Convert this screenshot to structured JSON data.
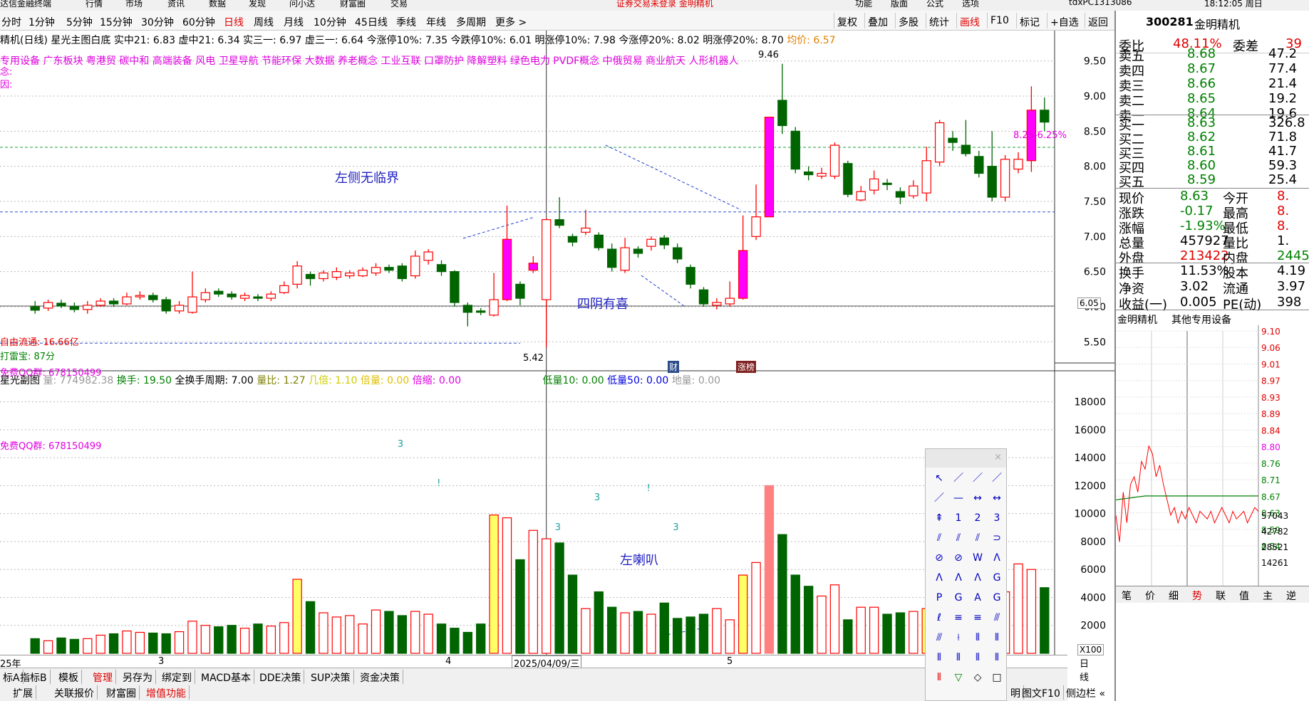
{
  "menu": {
    "items": [
      "达信金融终端",
      "行情",
      "市场",
      "资讯",
      "数据",
      "发现",
      "问小达",
      "财富圈",
      "交易"
    ],
    "notice": "证券交易未登录 金明精机",
    "right": [
      "功能",
      "版面",
      "公式",
      "选项"
    ],
    "account": "tdxPC1313086",
    "clock": "18:12:05 周日"
  },
  "periods": [
    "分时",
    "1分钟",
    "5分钟",
    "15分钟",
    "30分钟",
    "60分钟",
    "日线",
    "周线",
    "月线",
    "10分钟",
    "45日线",
    "季线",
    "年线",
    "多周期",
    "更多 >"
  ],
  "active_period": "日线",
  "toolbar": [
    "复权",
    "叠加",
    "多股",
    "统计",
    "画线",
    "F10",
    "标记",
    "+自选",
    "返回"
  ],
  "indicator_line": {
    "name": "精机(日线)",
    "items": [
      {
        "t": "星光主图白底",
        "c": "#000"
      },
      {
        "t": "实中21: 6.83",
        "c": "#000"
      },
      {
        "t": "虚中21: 6.34",
        "c": "#000"
      },
      {
        "t": "实三一: 6.97",
        "c": "#000"
      },
      {
        "t": "虚三一: 6.64",
        "c": "#000"
      },
      {
        "t": "今涨停10%: 7.35",
        "c": "#000"
      },
      {
        "t": "今跌停10%: 6.01",
        "c": "#000"
      },
      {
        "t": "明涨停10%: 7.98",
        "c": "#000"
      },
      {
        "t": "今涨停20%: 8.02",
        "c": "#000"
      },
      {
        "t": "明涨停20%: 8.70",
        "c": "#000"
      },
      {
        "t": "均价: 6.57",
        "c": "#e08000"
      }
    ]
  },
  "concepts": "专用设备  广东板块  粤港贸 碳中和 高端装备 风电 卫星导航 节能环保 大数据 养老概念 工业互联 口罩防护 降解塑料 绿色电力 PVDF概念 中俄贸易 商业航天 人形机器人",
  "side_labels": {
    "l1": "念:",
    "l2": "因:",
    "free_float": "自由流通: 16.66亿",
    "score": "打雷宝: 87分",
    "qq": "免费QQ群: 678150499"
  },
  "annotations": {
    "left_no_critical": "左侧无临界",
    "four_yin": "四阴有喜",
    "left_horn": "左喇叭",
    "high": "9.46",
    "low": "5.42",
    "band": "8.25-6.25%",
    "tag_cai": "财",
    "tag_zhang": "涨榜",
    "cursor_price": "6.05"
  },
  "sub_info": {
    "name": "星光副图",
    "items": [
      {
        "t": "量: 774982.38",
        "c": "#999"
      },
      {
        "t": "换手: 19.50",
        "c": "#008000"
      },
      {
        "t": "全换手周期: 7.00",
        "c": "#000"
      },
      {
        "t": "量比: 1.27",
        "c": "#808000"
      },
      {
        "t": "几倍: 1.10",
        "c": "#cccc00"
      },
      {
        "t": "倍量: 0.00",
        "c": "#e0c000"
      },
      {
        "t": "倍缩: 0.00",
        "c": "#e000e0"
      },
      {
        "t": "低量10: 0.00",
        "c": "#008000"
      },
      {
        "t": "低量50: 0.00",
        "c": "#0000e0"
      },
      {
        "t": "地量: 0.00",
        "c": "#999"
      }
    ]
  },
  "price_axis": [
    "9.50",
    "9.00",
    "8.50",
    "8.00",
    "7.50",
    "7.00",
    "6.50",
    "6.00",
    "5.50"
  ],
  "vol_axis": [
    "18000",
    "16000",
    "14000",
    "12000",
    "10000",
    "8000",
    "6000",
    "4000",
    "2000"
  ],
  "vol_unit": "X100",
  "dates": {
    "y": "25年",
    "m3": "3",
    "m4": "4",
    "cursor": "2025/04/09/三",
    "m5": "5",
    "period": "日线"
  },
  "chart_data": {
    "type": "candlestick",
    "ylim": [
      5.3,
      9.7
    ],
    "candles": [
      [
        6.0,
        5.95,
        6.08,
        5.9
      ],
      [
        5.98,
        6.06,
        6.1,
        5.94
      ],
      [
        6.05,
        6.01,
        6.1,
        5.98
      ],
      [
        6.0,
        5.96,
        6.06,
        5.92
      ],
      [
        5.96,
        6.02,
        6.08,
        5.9
      ],
      [
        6.02,
        6.08,
        6.12,
        6.0
      ],
      [
        6.08,
        6.04,
        6.12,
        6.0
      ],
      [
        6.04,
        6.14,
        6.2,
        6.02
      ],
      [
        6.14,
        6.16,
        6.22,
        6.1
      ],
      [
        6.16,
        6.1,
        6.2,
        6.06
      ],
      [
        6.1,
        5.94,
        6.14,
        5.9
      ],
      [
        5.94,
        6.02,
        6.08,
        5.9
      ],
      [
        5.92,
        6.14,
        6.5,
        5.9
      ],
      [
        6.1,
        6.2,
        6.26,
        6.06
      ],
      [
        6.22,
        6.18,
        6.26,
        6.14
      ],
      [
        6.18,
        6.14,
        6.22,
        6.1
      ],
      [
        6.12,
        6.16,
        6.2,
        6.08
      ],
      [
        6.14,
        6.12,
        6.18,
        6.08
      ],
      [
        6.12,
        6.18,
        6.22,
        6.08
      ],
      [
        6.2,
        6.3,
        6.36,
        6.18
      ],
      [
        6.32,
        6.58,
        6.65,
        6.26
      ],
      [
        6.46,
        6.4,
        6.5,
        6.3
      ],
      [
        6.4,
        6.48,
        6.52,
        6.36
      ],
      [
        6.42,
        6.5,
        6.56,
        6.38
      ],
      [
        6.44,
        6.48,
        6.52,
        6.4
      ],
      [
        6.44,
        6.52,
        6.56,
        6.42
      ],
      [
        6.48,
        6.56,
        6.62,
        6.44
      ],
      [
        6.56,
        6.52,
        6.6,
        6.48
      ],
      [
        6.58,
        6.4,
        6.62,
        6.36
      ],
      [
        6.44,
        6.72,
        6.8,
        6.4
      ],
      [
        6.66,
        6.78,
        6.82,
        6.6
      ],
      [
        6.6,
        6.5,
        6.66,
        6.44
      ],
      [
        6.5,
        6.06,
        6.52,
        6.0
      ],
      [
        6.02,
        5.92,
        6.06,
        5.72
      ],
      [
        5.94,
        5.92,
        5.98,
        5.88
      ],
      [
        5.88,
        6.1,
        6.48,
        5.86
      ],
      [
        6.1,
        6.96,
        7.44,
        6.08
      ],
      [
        6.32,
        6.12,
        6.36,
        6.02
      ],
      [
        6.52,
        6.62,
        6.72,
        6.48
      ],
      [
        6.1,
        7.24,
        7.26,
        5.42
      ],
      [
        7.24,
        7.16,
        7.56,
        7.12
      ],
      [
        7.0,
        6.92,
        7.04,
        6.86
      ],
      [
        7.06,
        7.12,
        7.38,
        7.02
      ],
      [
        7.02,
        6.84,
        7.06,
        6.8
      ],
      [
        6.82,
        6.56,
        6.9,
        6.5
      ],
      [
        6.52,
        6.84,
        6.98,
        6.48
      ],
      [
        6.82,
        6.76,
        6.86,
        6.7
      ],
      [
        6.86,
        6.96,
        7.0,
        6.8
      ],
      [
        6.98,
        6.88,
        7.02,
        6.82
      ],
      [
        6.84,
        6.68,
        6.9,
        6.62
      ],
      [
        6.56,
        6.32,
        6.6,
        6.26
      ],
      [
        6.24,
        6.04,
        6.28,
        6.0
      ],
      [
        6.02,
        6.06,
        6.12,
        5.96
      ],
      [
        6.04,
        6.12,
        6.36,
        6.0
      ],
      [
        6.12,
        6.8,
        7.3,
        6.1
      ],
      [
        7.0,
        7.28,
        7.74,
        6.95
      ],
      [
        7.28,
        8.7,
        8.7,
        7.28
      ],
      [
        8.94,
        8.58,
        9.46,
        8.46
      ],
      [
        8.5,
        7.96,
        8.56,
        7.9
      ],
      [
        7.92,
        7.88,
        8.0,
        7.8
      ],
      [
        7.86,
        7.9,
        7.98,
        7.82
      ],
      [
        7.86,
        8.3,
        8.34,
        7.82
      ],
      [
        8.04,
        7.6,
        8.08,
        7.56
      ],
      [
        7.52,
        7.64,
        7.72,
        7.5
      ],
      [
        7.66,
        7.82,
        7.94,
        7.6
      ],
      [
        7.76,
        7.74,
        7.82,
        7.66
      ],
      [
        7.64,
        7.56,
        7.7,
        7.46
      ],
      [
        7.58,
        7.72,
        7.8,
        7.54
      ],
      [
        7.62,
        8.08,
        8.28,
        7.5
      ],
      [
        8.06,
        8.62,
        8.66,
        8.0
      ],
      [
        8.4,
        8.34,
        8.5,
        8.22
      ],
      [
        8.3,
        8.18,
        8.66,
        8.14
      ],
      [
        8.14,
        7.9,
        8.22,
        7.84
      ],
      [
        8.0,
        7.56,
        8.5,
        7.5
      ],
      [
        7.56,
        8.1,
        8.16,
        7.5
      ],
      [
        7.96,
        8.1,
        8.2,
        7.9
      ],
      [
        8.08,
        8.8,
        9.14,
        7.92
      ],
      [
        8.8,
        8.63,
        8.98,
        8.5
      ]
    ],
    "volumes": [
      1050,
      900,
      1100,
      1000,
      1050,
      1300,
      1400,
      1600,
      1500,
      1450,
      1400,
      1550,
      2300,
      2000,
      1900,
      2000,
      1800,
      2100,
      1950,
      2200,
      5300,
      3700,
      2900,
      2600,
      2700,
      2100,
      3100,
      3000,
      2700,
      3000,
      2800,
      2100,
      1800,
      1500,
      2100,
      9900,
      9700,
      6700,
      8800,
      8200,
      7900,
      5600,
      3200,
      4400,
      3300,
      2900,
      3000,
      2800,
      3600,
      2500,
      2600,
      2800,
      3200,
      2400,
      5600,
      6500,
      12000,
      8500,
      5600,
      4800,
      4100,
      4900,
      2400,
      3300,
      3300,
      2800,
      2900,
      3000,
      3200,
      6700,
      7200,
      8600,
      6000,
      4200,
      4400,
      6400,
      6000,
      4700
    ],
    "vol_ylim": [
      0,
      19000
    ],
    "markers": [
      "3",
      "!",
      "3",
      "3",
      "!",
      "3",
      "!"
    ]
  },
  "quote": {
    "code": "300281",
    "name": "金明精机",
    "ask_label": "委比",
    "ask_ratio": "48.11%",
    "diff_label": "委差",
    "diff_val": "39",
    "sell": [
      [
        "卖五",
        "8.68",
        "47.2"
      ],
      [
        "卖四",
        "8.67",
        "77.4"
      ],
      [
        "卖三",
        "8.66",
        "21.4"
      ],
      [
        "卖二",
        "8.65",
        "19.2"
      ],
      [
        "卖一",
        "8.64",
        "19.6"
      ]
    ],
    "buy": [
      [
        "买一",
        "8.63",
        "326.8"
      ],
      [
        "买二",
        "8.62",
        "71.8"
      ],
      [
        "买三",
        "8.61",
        "41.7"
      ],
      [
        "买四",
        "8.60",
        "59.3"
      ],
      [
        "买五",
        "8.59",
        "25.4"
      ]
    ],
    "stats": [
      [
        "现价",
        "8.63",
        "今开",
        "8."
      ],
      [
        "涨跌",
        "-0.17",
        "最高",
        "8."
      ],
      [
        "涨幅",
        "-1.93%",
        "最低",
        "8."
      ],
      [
        "总量",
        "457927",
        "量比",
        "1."
      ],
      [
        "外盘",
        "213422",
        "内盘",
        "2445"
      ]
    ],
    "stats2": [
      [
        "换手",
        "11.53%",
        "股本",
        "4.19"
      ],
      [
        "净资",
        "3.02",
        "流通",
        "3.97"
      ],
      [
        "收益(一)",
        "0.005",
        "PE(动)",
        "398"
      ]
    ],
    "sector": "其他专用设备",
    "mini_name": "金明精机",
    "mini_axis": [
      "9.10",
      "9.06",
      "9.01",
      "8.97",
      "8.93",
      "8.89",
      "8.84",
      "8.80",
      "8.76",
      "8.71",
      "8.67",
      "8.63",
      "8.59",
      "8.54"
    ],
    "mini_vol": [
      "57043",
      "42782",
      "28521",
      "14261"
    ]
  },
  "bottom": {
    "row1": [
      "标A",
      "指标B",
      "模板",
      "管理",
      "另存为",
      "绑定到",
      "MACD基本",
      "DDE决策",
      "SUP决策",
      "资金决策"
    ],
    "row2": [
      "扩展",
      "关联报价",
      "财富圈",
      "增值功能"
    ],
    "right": [
      "明",
      "图文F10",
      "侧边栏 «"
    ],
    "tabs": [
      "笔",
      "价",
      "细",
      "势",
      "联",
      "值",
      "主",
      "逆"
    ]
  }
}
